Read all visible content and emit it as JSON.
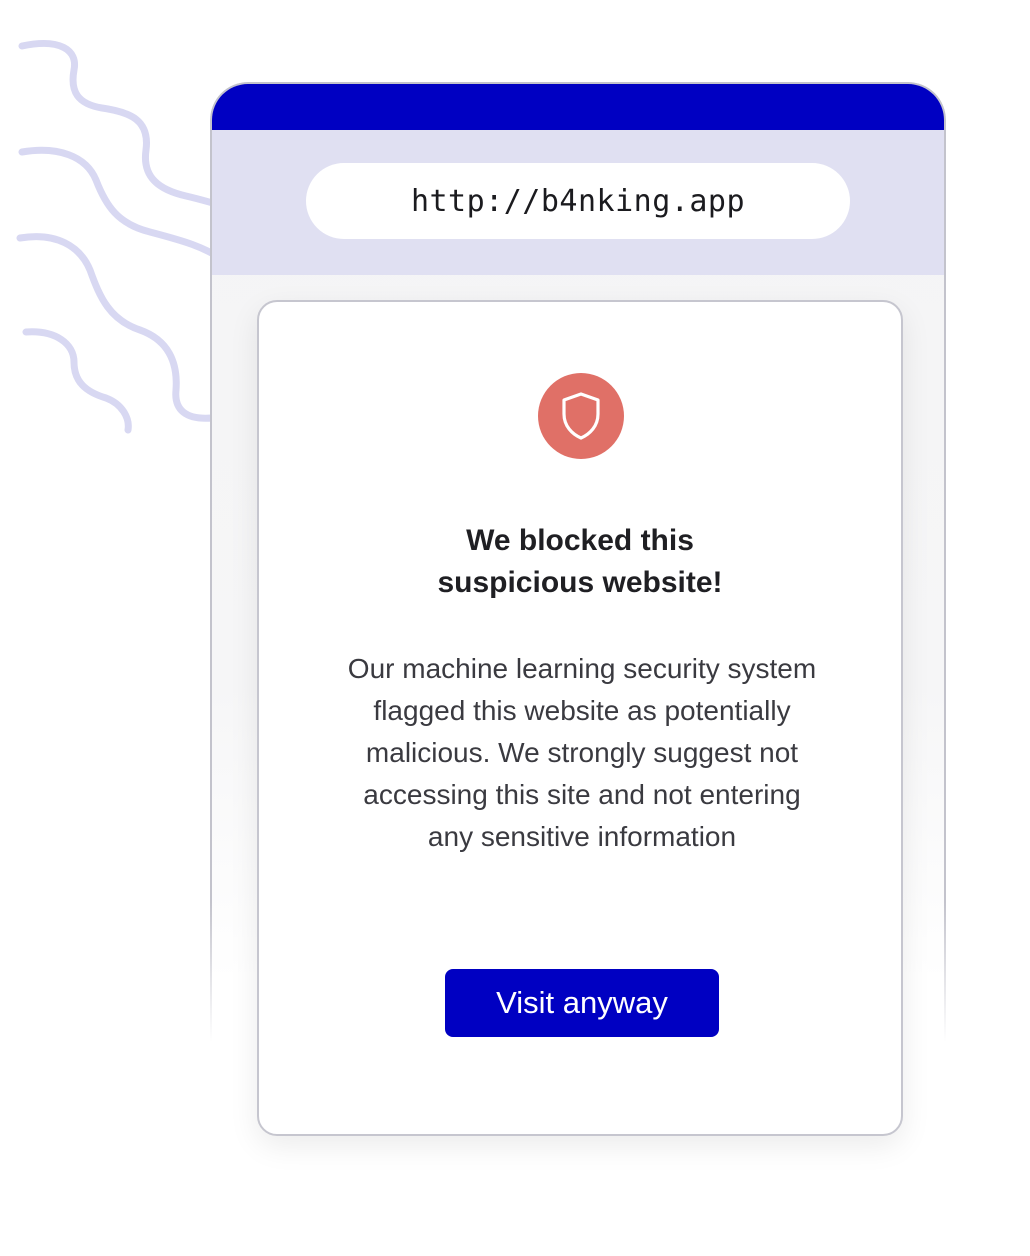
{
  "browser": {
    "url": "http://b4nking.app"
  },
  "warning": {
    "icon": "shield-icon",
    "headline_lines": [
      "We blocked this",
      "suspicious website!"
    ],
    "message_lines": [
      "Our machine learning security system",
      "flagged this website as potentially",
      "malicious. We strongly suggest not",
      "accessing this site and not entering",
      "any sensitive information"
    ],
    "button_label": "Visit anyway"
  },
  "colors": {
    "brand_blue": "#0000c2",
    "url_area": "#e0e0f2",
    "shield_badge": "#e07067",
    "squiggle": "#d8d8f2"
  }
}
